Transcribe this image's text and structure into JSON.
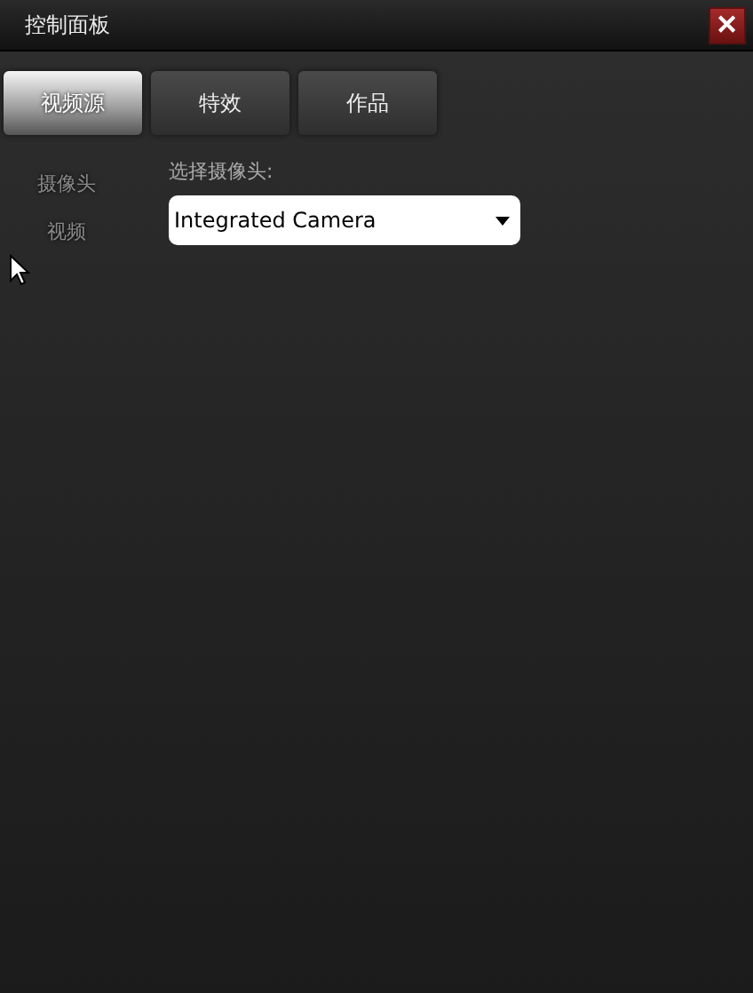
{
  "window": {
    "title": "控制面板",
    "close": "✕"
  },
  "tabs": [
    {
      "label": "视频源",
      "selected": true
    },
    {
      "label": "特效",
      "selected": false
    },
    {
      "label": "作品",
      "selected": false
    }
  ],
  "sidebar": {
    "items": [
      {
        "label": "摄像头"
      },
      {
        "label": "视频"
      }
    ]
  },
  "camera": {
    "label": "选择摄像头:",
    "value": "Integrated Camera"
  }
}
